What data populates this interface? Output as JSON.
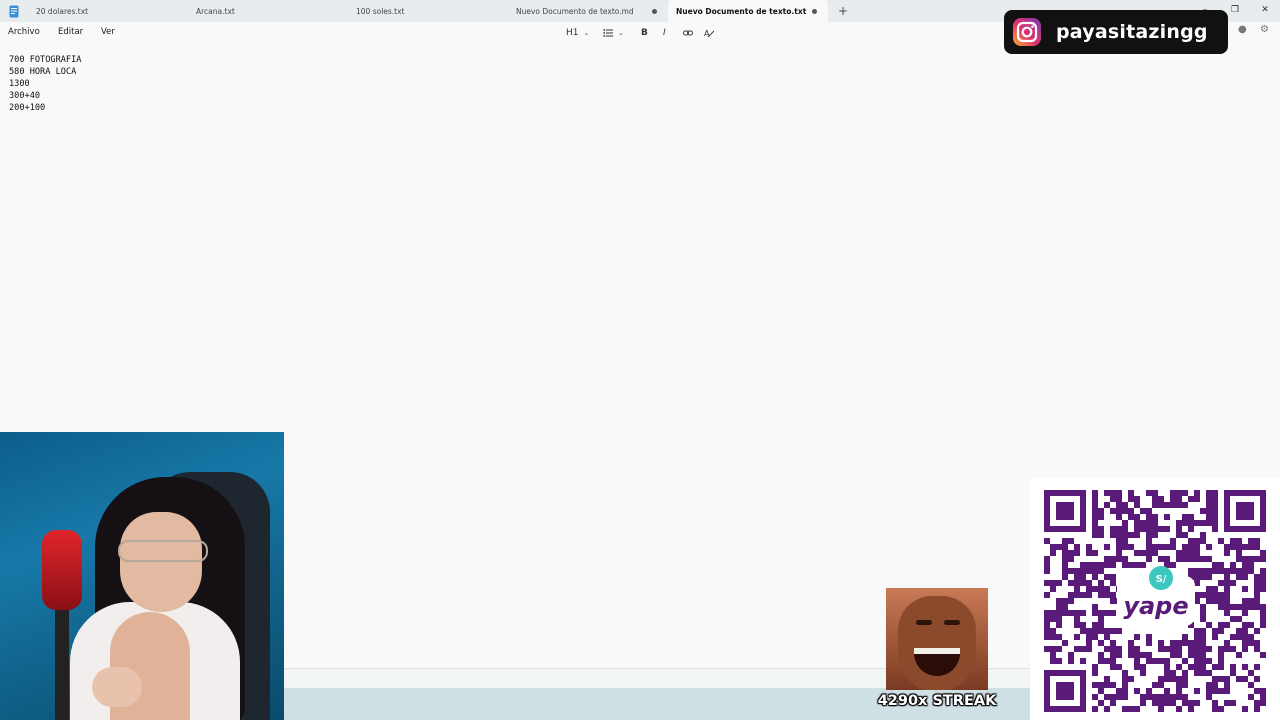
{
  "tabs": [
    {
      "label": "20 dolares.txt",
      "modified": false,
      "active": false
    },
    {
      "label": "Arcana.txt",
      "modified": false,
      "active": false
    },
    {
      "label": "100 soles.txt",
      "modified": false,
      "active": false
    },
    {
      "label": "Nuevo Documento de texto.md",
      "modified": true,
      "active": false
    },
    {
      "label": "Nuevo Documento de texto.txt",
      "modified": true,
      "active": true
    }
  ],
  "new_tab_label": "+",
  "window_controls": {
    "minimize": "–",
    "maximize": "❐",
    "close": "✕"
  },
  "menu": {
    "file": "Archivo",
    "edit": "Editar",
    "view": "Ver"
  },
  "toolbar": {
    "heading": "H1",
    "bold": "B",
    "italic": "I"
  },
  "document_lines": [
    "700 FOTOGRAFIA",
    "580 HORA LOCA",
    "1300",
    "300+40",
    "200+100"
  ],
  "overlay": {
    "instagram_handle": "payasitazingg",
    "streak_text": "4290x STREAK",
    "qr_brand": "yape",
    "qr_badge": "S/"
  },
  "colors": {
    "tabbar_bg": "#e7ecef",
    "editor_bg": "#f9f9f9",
    "qr_purple": "#5a1a7a",
    "yape_teal": "#3cc8c0"
  }
}
